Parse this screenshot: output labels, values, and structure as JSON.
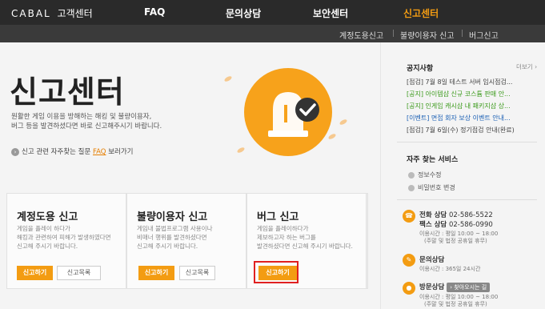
{
  "header": {
    "logo_brand": "CABAL",
    "logo_suffix": "고객센터",
    "nav": [
      {
        "label": "FAQ"
      },
      {
        "label": "문의상담"
      },
      {
        "label": "보안센터"
      },
      {
        "label": "신고센터"
      }
    ],
    "subnav": [
      {
        "label": "계정도용신고"
      },
      {
        "label": "불량이용자 신고"
      },
      {
        "label": "버그신고"
      }
    ]
  },
  "hero": {
    "title": "신고센터",
    "desc_line1": "원활한 게임 이용을 방해하는 해킹 및 불량이용자,",
    "desc_line2": "버그 등을 발견하셨다면 바로 신고해주시기 바랍니다.",
    "faq_prefix": "신고 관련 자주찾는 질문",
    "faq_link": "FAQ",
    "faq_suffix": "보러가기"
  },
  "cards": [
    {
      "title": "계정도용 신고",
      "line1": "게임을 플레이 하다가",
      "line2": "해킹과 관련하여 피해가 발생하였다면",
      "line3": "신고해 주시기 바랍니다.",
      "report_button": "신고하기",
      "list_button": "신고목록"
    },
    {
      "title": "불량이용자 신고",
      "line1": "게임내 불법프로그램 사용이나",
      "line2": "비매너 행위를 발견하셨다면",
      "line3": "신고해 주시기 바랍니다.",
      "report_button": "신고하기",
      "list_button": "신고목록"
    },
    {
      "title": "버그 신고",
      "line1": "게임을 플레이하다가",
      "line2": "제보하고자 하는 버그를",
      "line3": "발견하셨다면 신고해 주시기 바랍니다.",
      "report_button": "신고하기"
    }
  ],
  "sidebar": {
    "notice_title": "공지사항",
    "more": "더보기 ›",
    "notices": [
      {
        "text": "[점검] 7월 8일 테스트 서버 임시점검...",
        "color": "#444444"
      },
      {
        "text": "[공지] 아이템샵 신규 코스튬 판매 안...",
        "color": "#3a9a1a"
      },
      {
        "text": "[공지] 인게임 캐시샵 내 패키지샵 상...",
        "color": "#3a9a1a"
      },
      {
        "text": "[이벤트] 면접 회자 보상 이벤트 안내...",
        "color": "#1a5fb4"
      },
      {
        "text": "[점검] 7월 6일(수) 정기점검 안내(완료)",
        "color": "#444444"
      }
    ],
    "faq_title": "자주 찾는 서비스",
    "faq_items": [
      {
        "label": "정보수정"
      },
      {
        "label": "비밀번호 변경"
      }
    ],
    "contact": {
      "phone_label": "전화 상담",
      "phone": "02-586-5522",
      "fax_label": "팩스 상담",
      "fax": "02-586-0990",
      "phone_hours": "이용시간 : 평일 10:00 ~ 18:00",
      "phone_hours_note": "(주말 및 법정 공휴일 휴무)",
      "inquiry_label": "문의상담",
      "inquiry_hours": "이용시간 : 365일 24시간",
      "visit_label": "방문상담",
      "visit_chip": "› 찾아오시는 길",
      "visit_hours": "이용시간 : 평일 10:00 ~ 18:00",
      "visit_hours_note": "(주말 및 법정 공휴일 휴무)"
    }
  },
  "colors": {
    "accent": "#f39c12",
    "topbar": "#2a2a2a",
    "highlight": "#e02020"
  }
}
